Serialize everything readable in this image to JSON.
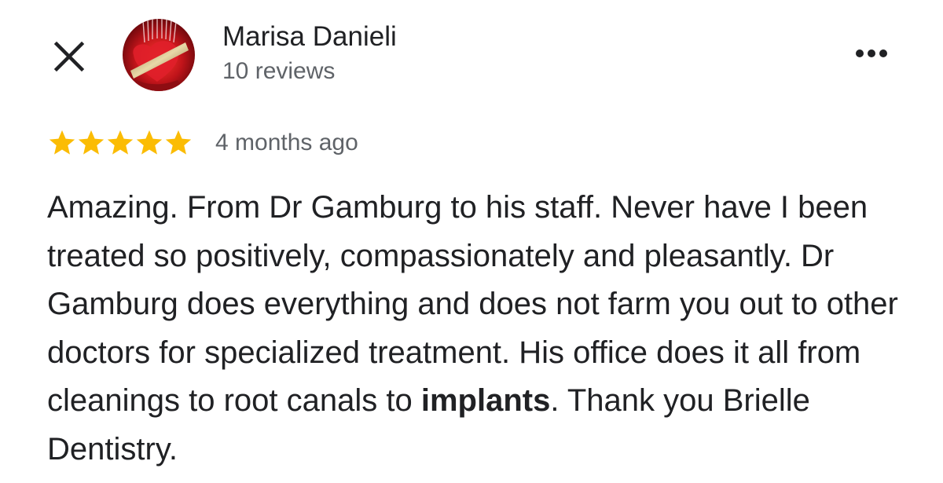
{
  "header": {
    "close_icon": "close-icon",
    "avatar_icon": "profile-photo",
    "reviewer_name": "Marisa Danieli",
    "review_count": "10 reviews",
    "more_icon": "more-horizontal-icon"
  },
  "review": {
    "rating": 5,
    "rating_max": 5,
    "star_icon": "star-icon",
    "star_color": "#FBBC04",
    "time_ago": "4 months ago",
    "text_before_highlight": "Amazing. From Dr Gamburg to his staff. Never have I been treated so positively, compassionately and pleasantly. Dr Gamburg does everything and does not farm you out to other doctors for specialized treatment. His office does it all from cleanings to root canals to ",
    "text_highlight": "implants",
    "text_after_highlight": ". Thank you Brielle Dentistry."
  },
  "colors": {
    "text_primary": "#202124",
    "text_secondary": "#5f6368",
    "avatar_red": "#c0141a"
  }
}
